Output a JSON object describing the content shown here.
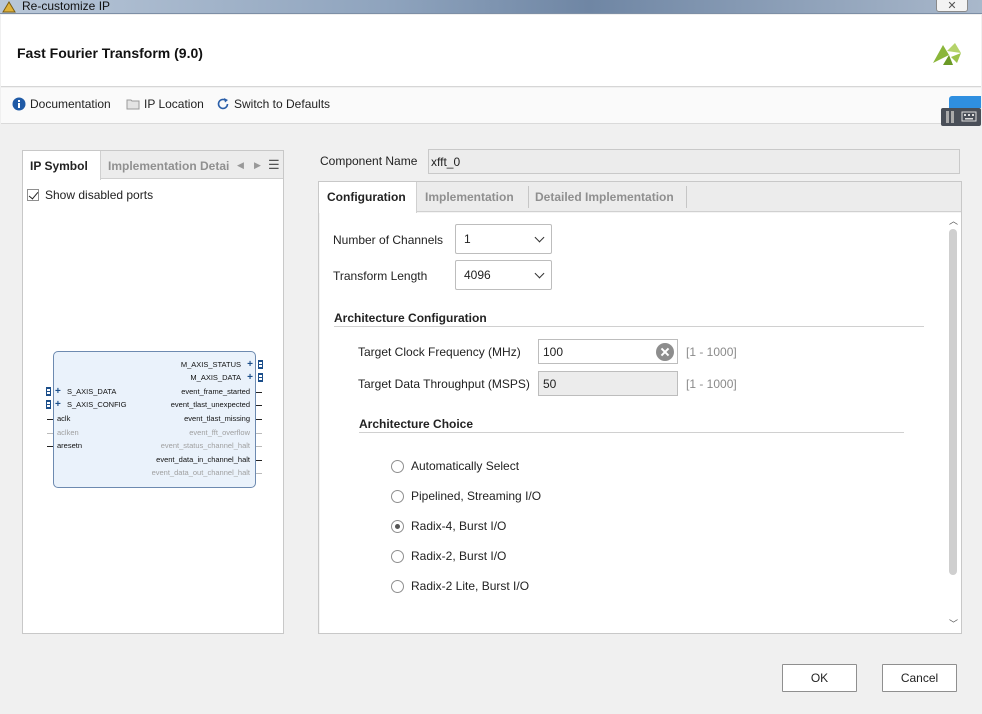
{
  "window": {
    "title": "Re-customize IP",
    "close_glyph": "✕"
  },
  "header": {
    "title": "Fast Fourier Transform (9.0)",
    "logo": "xilinx-logo"
  },
  "toolbar": {
    "documentation": "Documentation",
    "ip_location": "IP Location",
    "switch_defaults": "Switch to Defaults"
  },
  "left_panel": {
    "tabs": [
      "IP Symbol",
      "Implementation Detai"
    ],
    "show_disabled_ports": "Show disabled ports",
    "symbol": {
      "left_ports": [
        "S_AXIS_DATA",
        "S_AXIS_CONFIG",
        "aclk",
        "aclken",
        "aresetn"
      ],
      "right_ports": [
        "M_AXIS_STATUS",
        "M_AXIS_DATA",
        "event_frame_started",
        "event_tlast_unexpected",
        "event_tlast_missing",
        "event_fft_overflow",
        "event_status_channel_halt",
        "event_data_in_channel_halt",
        "event_data_out_channel_halt"
      ]
    }
  },
  "component": {
    "label": "Component Name",
    "value": "xfft_0"
  },
  "config": {
    "tabs": [
      "Configuration",
      "Implementation",
      "Detailed Implementation"
    ],
    "channels": {
      "label": "Number of Channels",
      "value": "1"
    },
    "transform_length": {
      "label": "Transform Length",
      "value": "4096"
    },
    "arch_config_title": "Architecture Configuration",
    "clock": {
      "label": "Target Clock Frequency (MHz)",
      "value": "100",
      "range": "[1 - 1000]"
    },
    "throughput": {
      "label": "Target Data Throughput (MSPS)",
      "value": "50",
      "range": "[1 - 1000]"
    },
    "arch_choice_title": "Architecture Choice",
    "choices": [
      {
        "label": "Automatically Select",
        "selected": false
      },
      {
        "label": "Pipelined, Streaming I/O",
        "selected": false
      },
      {
        "label": "Radix-4, Burst I/O",
        "selected": true
      },
      {
        "label": "Radix-2, Burst I/O",
        "selected": false
      },
      {
        "label": "Radix-2 Lite, Burst I/O",
        "selected": false
      }
    ]
  },
  "buttons": {
    "ok": "OK",
    "cancel": "Cancel"
  }
}
